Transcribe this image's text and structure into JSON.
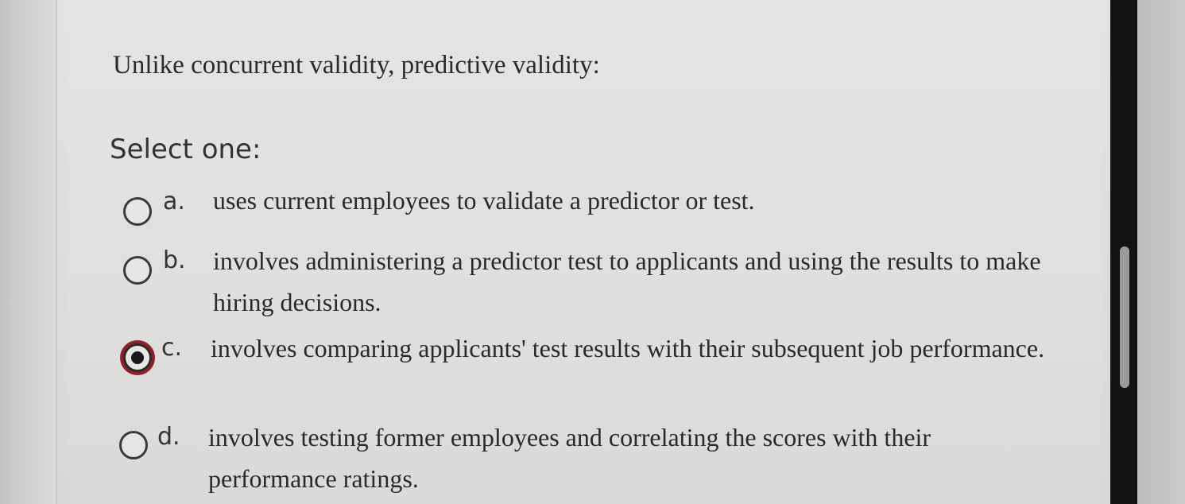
{
  "question": {
    "text": "Unlike concurrent validity, predictive validity:",
    "prompt": "Select one:"
  },
  "options": [
    {
      "letter": "a.",
      "text": "uses current employees to validate a predictor or test.",
      "selected": false
    },
    {
      "letter": "b.",
      "text": "involves administering a predictor test to applicants and using the results to make hiring decisions.",
      "selected": false
    },
    {
      "letter": "c.",
      "text": "involves comparing applicants' test results with their subsequent job performance.",
      "selected": true
    },
    {
      "letter": "d.",
      "text": "involves testing former employees and correlating the scores with their performance ratings.",
      "selected": false
    }
  ],
  "colors": {
    "focus_ring": "#8e1f2b",
    "text": "#2a2a2a",
    "scrollbar_track": "#121212",
    "scrollbar_thumb": "#9a9a9a"
  }
}
